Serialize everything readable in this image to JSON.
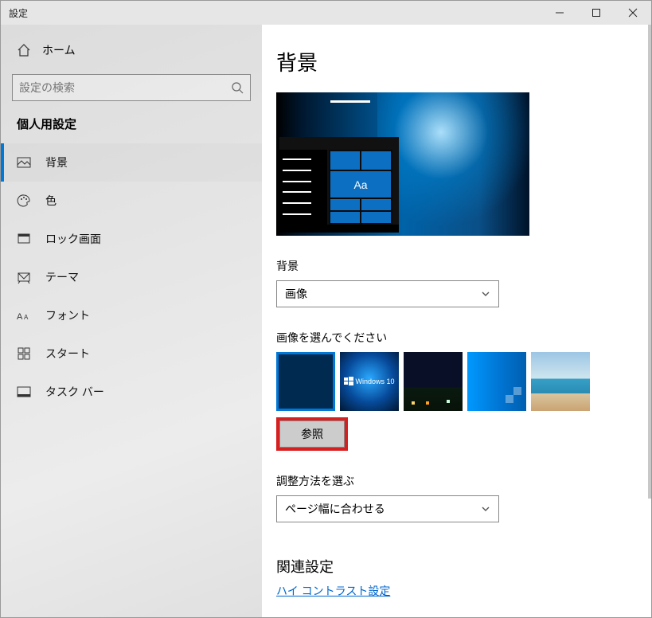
{
  "window": {
    "title": "設定"
  },
  "winbtns": {
    "min": "—",
    "max": "☐",
    "close": "✕"
  },
  "sidebar": {
    "home": "ホーム",
    "search_placeholder": "設定の検索",
    "category": "個人用設定",
    "items": [
      {
        "label": "背景"
      },
      {
        "label": "色"
      },
      {
        "label": "ロック画面"
      },
      {
        "label": "テーマ"
      },
      {
        "label": "フォント"
      },
      {
        "label": "スタート"
      },
      {
        "label": "タスク バー"
      }
    ]
  },
  "main": {
    "heading": "背景",
    "preview_tile_label": "Aa",
    "bg_label": "背景",
    "bg_value": "画像",
    "choose_label": "画像を選んでください",
    "browse": "参照",
    "fit_label": "調整方法を選ぶ",
    "fit_value": "ページ幅に合わせる",
    "related": "関連設定",
    "link1": "ハイ コントラスト設定",
    "thumb_win_label": "Windows 10"
  }
}
